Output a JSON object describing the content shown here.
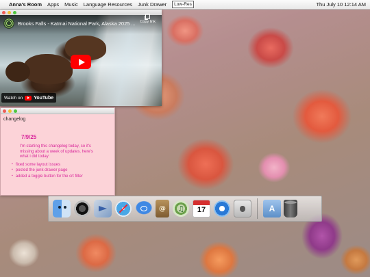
{
  "menubar": {
    "apple_icon": "",
    "app_name": "Anna's Room",
    "items": [
      "Apps",
      "Music",
      "Language Resources",
      "Junk Drawer"
    ],
    "lowres_label": "Low-Res",
    "clock": "Thu July 10  12:14 AM"
  },
  "video": {
    "title": "Brooks Falls - Katmai National Park, Alaska 2025 ...",
    "copy_link_label": "Copy link",
    "watch_on_label": "Watch on",
    "youtube_label": "YouTube"
  },
  "changelog": {
    "heading": "changelog",
    "date": "7/9/25",
    "intro": "I'm starting this changelog today, so it's missing about a week of updates. here's what i did today:",
    "entries": [
      "fixed some layout issues",
      "posted the junk drawer page",
      "added a toggle button for the crt filter"
    ]
  },
  "dock": {
    "icons": [
      "finder-icon",
      "dashboard-icon",
      "mail-icon",
      "safari-icon",
      "ichat-icon",
      "dictionary-icon",
      "itunes-icon",
      "ical-icon",
      "quicktime-icon",
      "system-preferences-icon",
      "applications-folder-icon",
      "trash-icon"
    ],
    "ical_day": "17"
  },
  "colors": {
    "changelog_bg": "#fcd3d8",
    "changelog_text": "#d9279b",
    "youtube_red": "#ff0000"
  }
}
